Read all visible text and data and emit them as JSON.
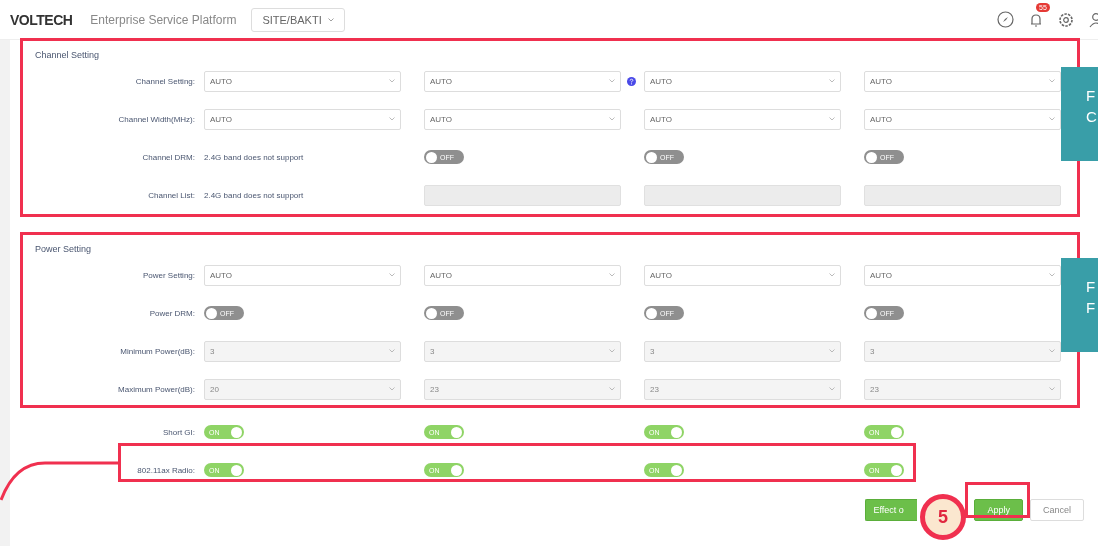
{
  "header": {
    "logo": "VOLTECH",
    "title": "Enterprise Service Platform",
    "site": "SITE/BAKTI",
    "notifications": "55"
  },
  "sections": [
    {
      "title": "Channel Setting",
      "rows": [
        {
          "label": "Channel Setting:",
          "cells": [
            {
              "kind": "select",
              "value": "AUTO",
              "disabled": false
            },
            {
              "kind": "select",
              "value": "AUTO",
              "disabled": false,
              "help": true
            },
            {
              "kind": "select",
              "value": "AUTO",
              "disabled": false
            },
            {
              "kind": "select",
              "value": "AUTO",
              "disabled": false
            }
          ]
        },
        {
          "label": "Channel Width(MHz):",
          "cells": [
            {
              "kind": "select",
              "value": "AUTO",
              "disabled": false
            },
            {
              "kind": "select",
              "value": "AUTO",
              "disabled": false
            },
            {
              "kind": "select",
              "value": "AUTO",
              "disabled": false
            },
            {
              "kind": "select",
              "value": "AUTO",
              "disabled": false
            }
          ]
        },
        {
          "label": "Channel DRM:",
          "cells": [
            {
              "kind": "note",
              "text": "2.4G band does not support"
            },
            {
              "kind": "toggle",
              "on": false,
              "text": "OFF"
            },
            {
              "kind": "toggle",
              "on": false,
              "text": "OFF"
            },
            {
              "kind": "toggle",
              "on": false,
              "text": "OFF"
            }
          ]
        },
        {
          "label": "Channel List:",
          "cells": [
            {
              "kind": "note",
              "text": "2.4G band does not support"
            },
            {
              "kind": "input",
              "disabled": true
            },
            {
              "kind": "input",
              "disabled": true
            },
            {
              "kind": "input",
              "disabled": true
            }
          ]
        }
      ]
    },
    {
      "title": "Power Setting",
      "rows": [
        {
          "label": "Power Setting:",
          "cells": [
            {
              "kind": "select",
              "value": "AUTO",
              "disabled": false
            },
            {
              "kind": "select",
              "value": "AUTO",
              "disabled": false
            },
            {
              "kind": "select",
              "value": "AUTO",
              "disabled": false
            },
            {
              "kind": "select",
              "value": "AUTO",
              "disabled": false
            }
          ]
        },
        {
          "label": "Power DRM:",
          "cells": [
            {
              "kind": "toggle",
              "on": false,
              "text": "OFF"
            },
            {
              "kind": "toggle",
              "on": false,
              "text": "OFF"
            },
            {
              "kind": "toggle",
              "on": false,
              "text": "OFF"
            },
            {
              "kind": "toggle",
              "on": false,
              "text": "OFF"
            }
          ]
        },
        {
          "label": "Minimum Power(dB):",
          "cells": [
            {
              "kind": "select",
              "value": "3",
              "disabled": true
            },
            {
              "kind": "select",
              "value": "3",
              "disabled": true
            },
            {
              "kind": "select",
              "value": "3",
              "disabled": true
            },
            {
              "kind": "select",
              "value": "3",
              "disabled": true
            }
          ]
        },
        {
          "label": "Maximum Power(dB):",
          "cells": [
            {
              "kind": "select",
              "value": "20",
              "disabled": true
            },
            {
              "kind": "select",
              "value": "23",
              "disabled": true
            },
            {
              "kind": "select",
              "value": "23",
              "disabled": true
            },
            {
              "kind": "select",
              "value": "23",
              "disabled": true
            }
          ]
        }
      ]
    }
  ],
  "extra_rows": [
    {
      "label": "Short GI:",
      "cells": [
        {
          "kind": "toggle",
          "on": true,
          "text": "ON"
        },
        {
          "kind": "toggle",
          "on": true,
          "text": "ON"
        },
        {
          "kind": "toggle",
          "on": true,
          "text": "ON"
        },
        {
          "kind": "toggle",
          "on": true,
          "text": "ON"
        }
      ]
    },
    {
      "label": "802.11ax Radio:",
      "cells": [
        {
          "kind": "toggle",
          "on": true,
          "text": "ON"
        },
        {
          "kind": "toggle",
          "on": true,
          "text": "ON"
        },
        {
          "kind": "toggle",
          "on": true,
          "text": "ON"
        },
        {
          "kind": "toggle",
          "on": true,
          "text": "ON"
        }
      ]
    }
  ],
  "buttons": [
    {
      "label": "Effect o",
      "kind": "primary"
    },
    {
      "label": "Apply",
      "kind": "primary"
    },
    {
      "label": "Cancel",
      "kind": "default"
    }
  ],
  "annotations": {
    "step": "5",
    "callouts": [
      {
        "lines": [
          "F",
          "C"
        ]
      },
      {
        "lines": [
          "F",
          "F"
        ]
      }
    ]
  }
}
